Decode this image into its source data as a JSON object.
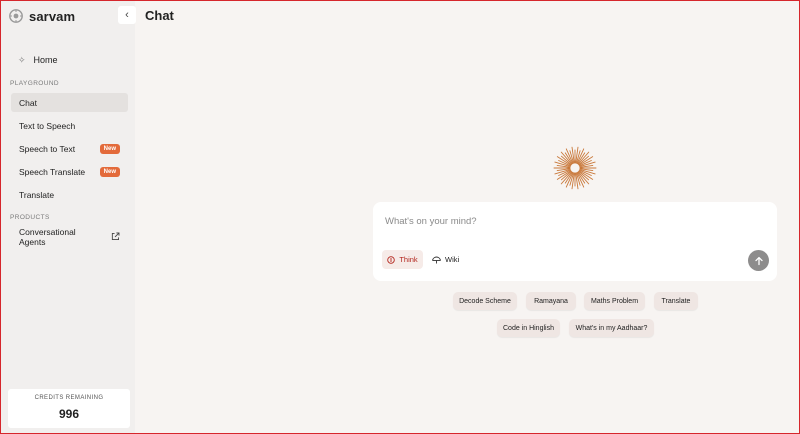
{
  "brand": {
    "name": "sarvam"
  },
  "sidebar": {
    "home_label": "Home",
    "playground_label": "PLAYGROUND",
    "playground_items": [
      {
        "label": "Chat",
        "active": true,
        "badge": ""
      },
      {
        "label": "Text to Speech",
        "active": false,
        "badge": ""
      },
      {
        "label": "Speech to Text",
        "active": false,
        "badge": "New"
      },
      {
        "label": "Speech Translate",
        "active": false,
        "badge": "New"
      },
      {
        "label": "Translate",
        "active": false,
        "badge": ""
      }
    ],
    "products_label": "PRODUCTS",
    "products_items": [
      {
        "label": "Conversational Agents",
        "external": true
      }
    ],
    "credits_label": "CREDITS REMAINING",
    "credits_value": "996"
  },
  "main": {
    "title": "Chat",
    "composer": {
      "placeholder": "What's on your mind?",
      "think_label": "Think",
      "wiki_label": "Wiki"
    },
    "suggestions": [
      "Decode Scheme",
      "Ramayana",
      "Maths Problem",
      "Translate",
      "Code in Hinglish",
      "What's in my Aadhaar?"
    ]
  },
  "colors": {
    "accent": "#e36a3a",
    "think_text": "#b3261e",
    "burst": "#c9783a",
    "send_button": "#8d8c8c"
  }
}
